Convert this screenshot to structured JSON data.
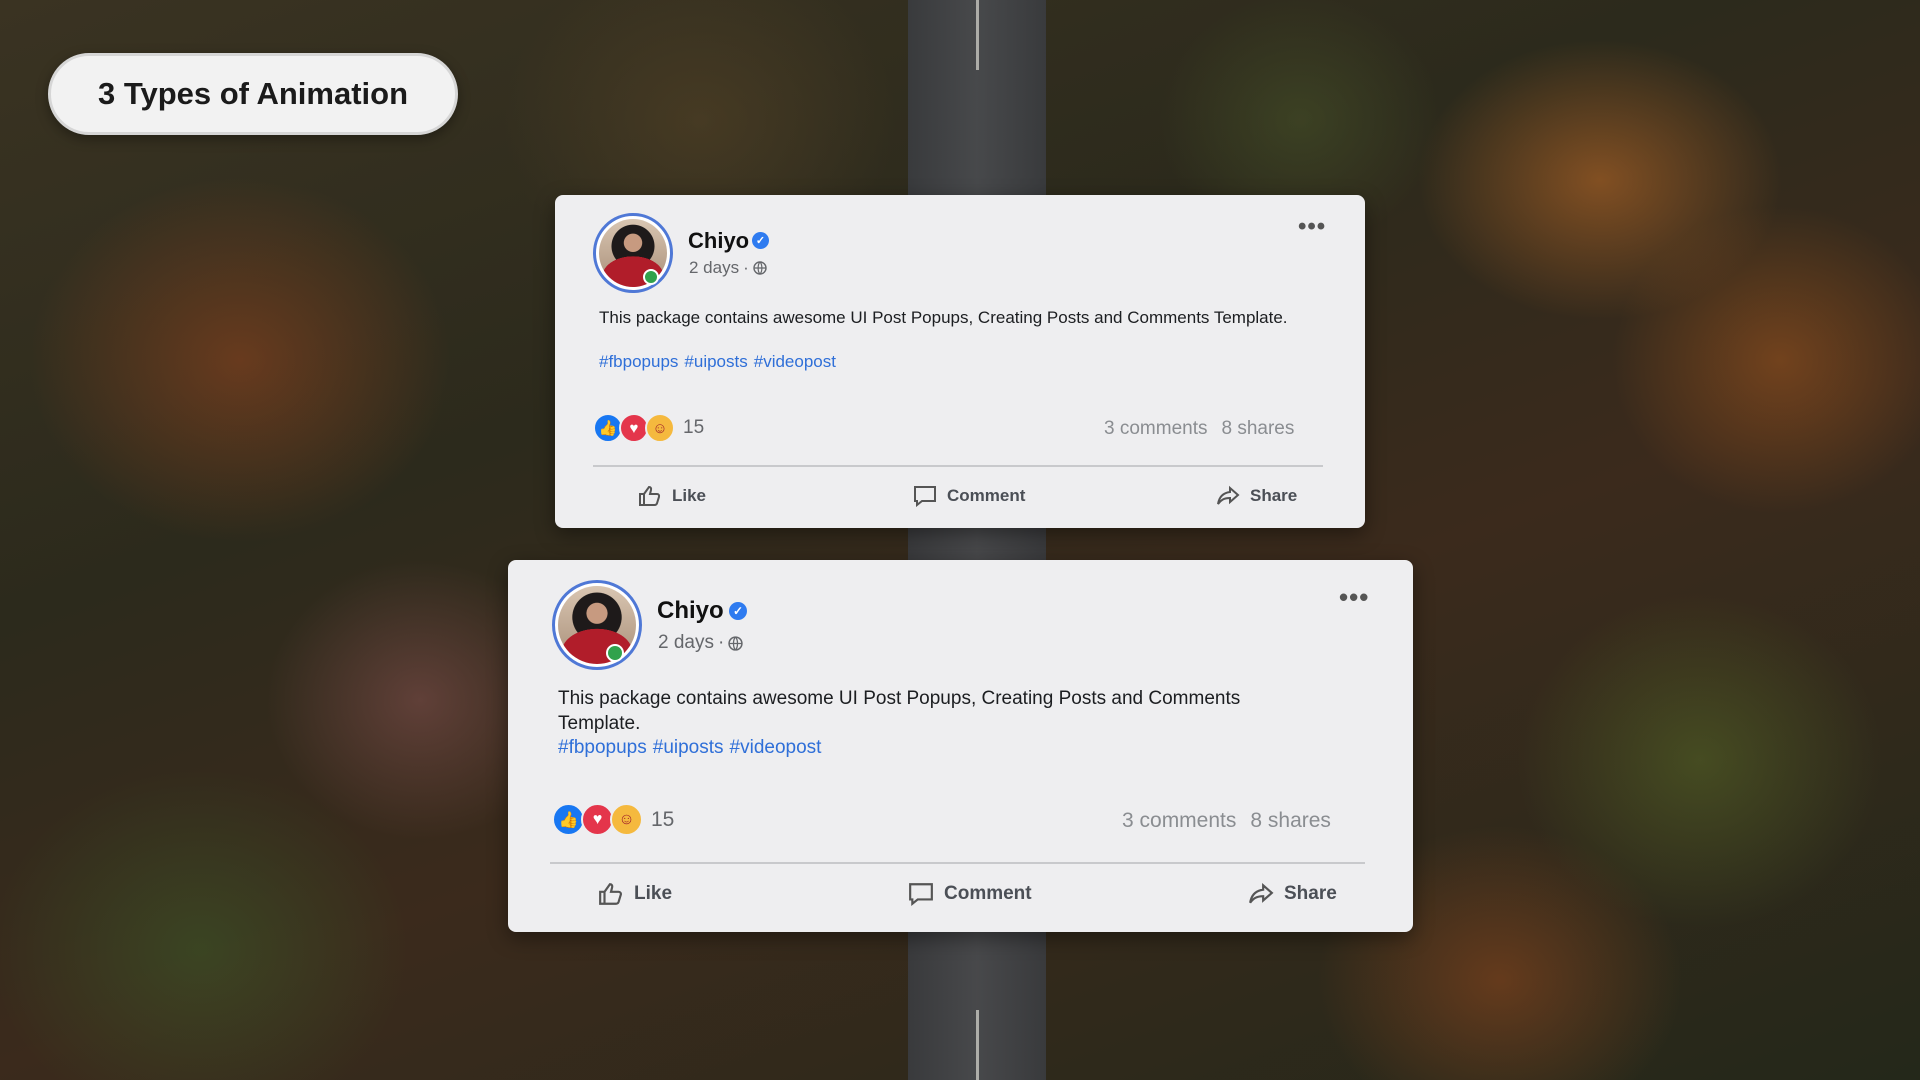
{
  "header": {
    "title": "3 Types of Animation"
  },
  "posts": [
    {
      "author": "Chiyo",
      "time": "2 days",
      "separator": "·",
      "text": "This package contains awesome UI Post Popups, Creating Posts and Comments Template.",
      "tags": [
        "#fbpopups",
        "#uiposts",
        "#videopost"
      ],
      "reaction_count": "15",
      "comments": "3 comments",
      "shares": "8 shares",
      "actions": {
        "like": "Like",
        "comment": "Comment",
        "share": "Share"
      }
    },
    {
      "author": "Chiyo",
      "time": "2 days",
      "separator": "·",
      "text": "This package contains awesome UI Post Popups, Creating Posts and Comments Template.",
      "tags": [
        "#fbpopups",
        "#uiposts",
        "#videopost"
      ],
      "reaction_count": "15",
      "comments": "3 comments",
      "shares": "8 shares",
      "actions": {
        "like": "Like",
        "comment": "Comment",
        "share": "Share"
      }
    }
  ],
  "colors": {
    "accent": "#2f6fd8",
    "verified": "#2e7bf0",
    "online": "#31a24c",
    "card_bg": "#eeeef0"
  },
  "icons": [
    "more-icon",
    "globe-icon",
    "verified-icon",
    "like-reaction-icon",
    "love-reaction-icon",
    "care-reaction-icon",
    "thumbs-up-icon",
    "comment-icon",
    "share-icon"
  ]
}
